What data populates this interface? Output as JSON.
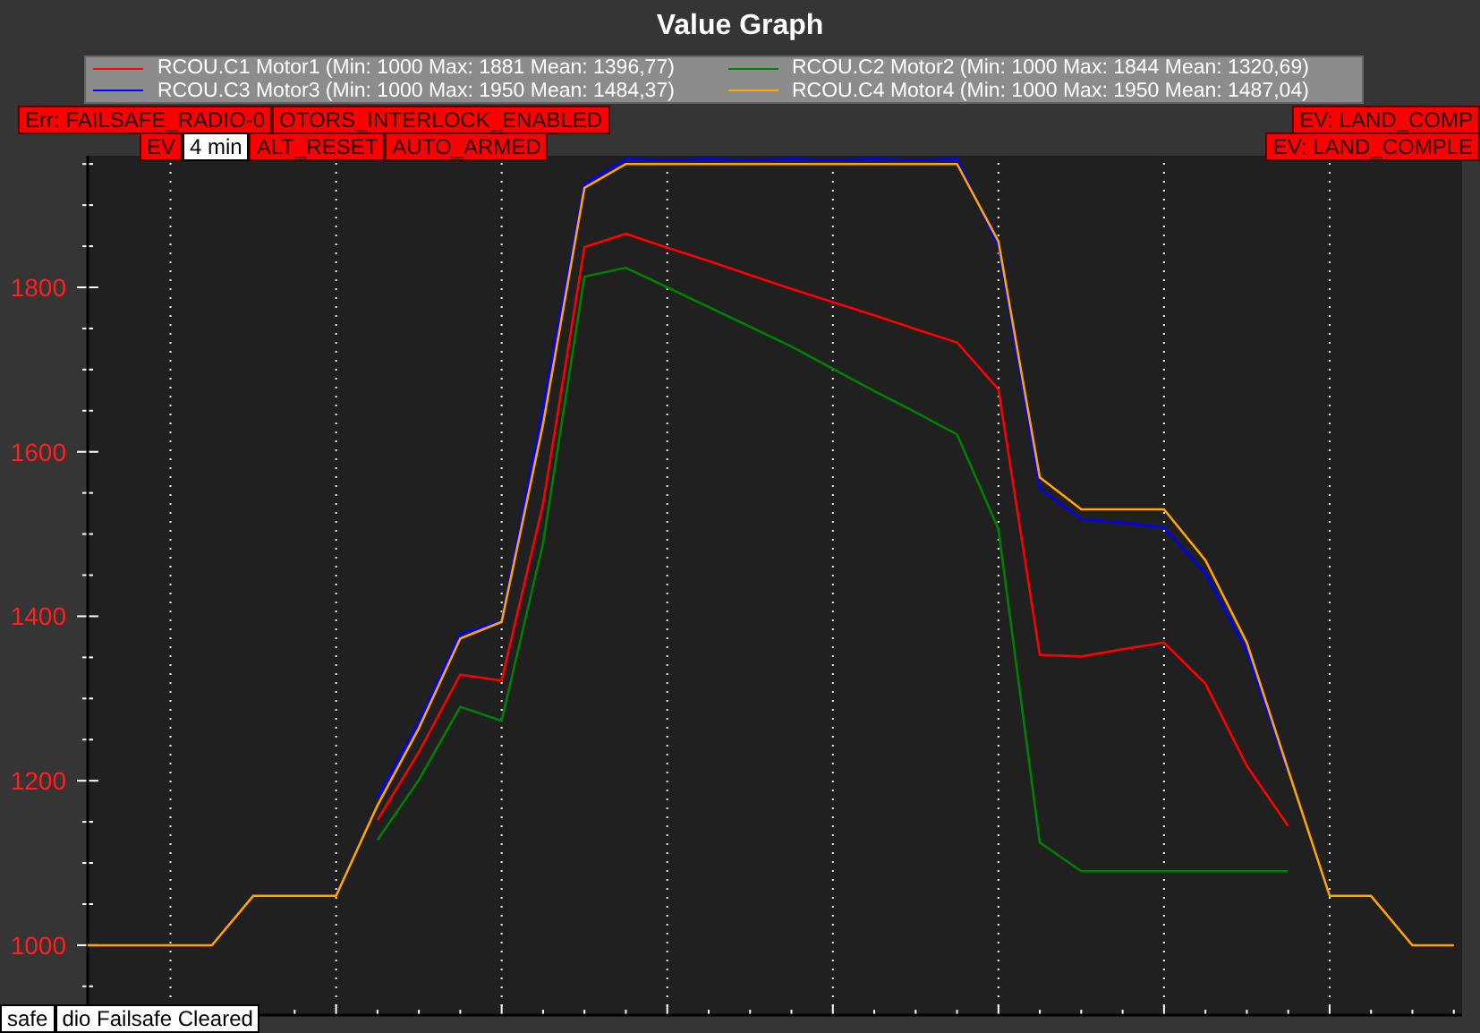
{
  "window": {
    "title": "Value Graph"
  },
  "chart_data": {
    "type": "line",
    "grid": true,
    "categories": [
      null,
      null,
      null,
      null,
      null,
      null,
      null,
      null,
      null,
      null,
      null,
      null,
      null,
      null,
      null,
      null,
      null,
      null,
      null,
      null,
      null,
      null,
      null,
      null,
      null,
      null,
      null,
      null,
      null,
      null,
      null,
      null,
      null,
      null
    ],
    "series": [
      {
        "name": "RCOU.C1 Motor1 (Min: 1000 Max: 1881 Mean: 1396,77)",
        "color": "#ff0000",
        "values": [
          null,
          null,
          null,
          null,
          null,
          null,
          null,
          1152,
          1235,
          1329,
          1322,
          1537,
          1849,
          1865,
          1848,
          1832,
          1815,
          1798,
          1782,
          1766,
          1749,
          1733,
          1676,
          1353,
          1351,
          1360,
          1368,
          1318,
          1218,
          1145,
          null,
          null,
          null,
          null
        ]
      },
      {
        "name": "RCOU.C2 Motor2 (Min: 1000 Max: 1844 Mean: 1320,69)",
        "color": "#008000",
        "values": [
          null,
          null,
          null,
          null,
          null,
          null,
          null,
          1128,
          1201,
          1290,
          1273,
          1489,
          1813,
          1824,
          1800,
          1776,
          1752,
          1728,
          1701,
          1674,
          1648,
          1621,
          1506,
          1125,
          1090,
          1090,
          1090,
          1090,
          1090,
          1090,
          null,
          null,
          null,
          null
        ]
      },
      {
        "name": "RCOU.C3 Motor3 (Min: 1000 Max: 1950 Mean: 1484,37)",
        "color": "#0000ff",
        "values": [
          null,
          null,
          null,
          null,
          null,
          null,
          null,
          1180,
          1272,
          1379,
          1394,
          1655,
          1926,
          1956,
          1955,
          1956,
          1955,
          1956,
          1955,
          1956,
          1955,
          1956,
          1850,
          1556,
          1518,
          1514,
          1508,
          1452,
          1358,
          1210,
          null,
          null,
          null,
          null
        ]
      },
      {
        "name": "RCOU.C4 Motor4 (Min: 1000 Max: 1950 Mean: 1487,04)",
        "color": "#ffa500",
        "values": [
          1000,
          1000,
          1000,
          1000,
          1060,
          1060,
          1060,
          1170,
          1264,
          1373,
          1393,
          1634,
          1921,
          1950,
          1950,
          1950,
          1950,
          1950,
          1950,
          1950,
          1950,
          1950,
          1856,
          1569,
          1530,
          1530,
          1530,
          1468,
          1368,
          1213,
          1060,
          1060,
          1000,
          1000
        ]
      }
    ],
    "ylim": [
      915,
      1960
    ],
    "yticks": [
      1000,
      1200,
      1400,
      1600,
      1800
    ]
  },
  "event_rows": [
    {
      "left": [
        {
          "kind": "event",
          "text": "Err: FAILSAFE_RADIO-0"
        },
        {
          "kind": "event",
          "text": "OTORS_INTERLOCK_ENABLED"
        }
      ],
      "right": [
        {
          "kind": "event",
          "text": "EV: LAND_COMP"
        }
      ]
    },
    {
      "left": [
        {
          "kind": "event",
          "text": "EV"
        },
        {
          "kind": "tooltip",
          "text": "4 min"
        },
        {
          "kind": "event",
          "text": "ALT_RESET"
        },
        {
          "kind": "event",
          "text": "AUTO_ARMED"
        }
      ],
      "right": [
        {
          "kind": "event",
          "text": "EV: LAND_COMPLE"
        }
      ]
    }
  ],
  "bottom_messages": [
    "safe",
    "dio Failsafe Cleared"
  ]
}
